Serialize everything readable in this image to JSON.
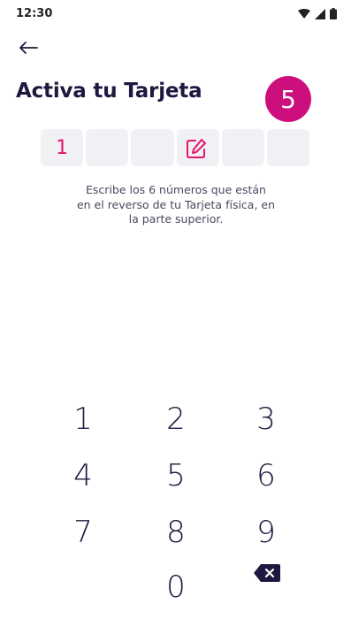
{
  "status": {
    "time": "12:30"
  },
  "header": {
    "title": "Activa tu Tarjeta",
    "step": "5"
  },
  "code": {
    "digits": [
      "1",
      "",
      "",
      "",
      "",
      ""
    ]
  },
  "instructions": {
    "line1": "Escribe los 6 números que están",
    "line2": "en el reverso de tu Tarjeta física, en",
    "line3": "la parte superior."
  },
  "keypad": {
    "k1": "1",
    "k2": "2",
    "k3": "3",
    "k4": "4",
    "k5": "5",
    "k6": "6",
    "k7": "7",
    "k8": "8",
    "k9": "9",
    "k0": "0"
  },
  "colors": {
    "accent": "#cc0f7c",
    "digit": "#e3156f",
    "text": "#1e1840"
  },
  "icons": [
    "wifi-icon",
    "signal-icon",
    "battery-icon",
    "back-arrow-icon",
    "edit-icon",
    "backspace-icon"
  ]
}
